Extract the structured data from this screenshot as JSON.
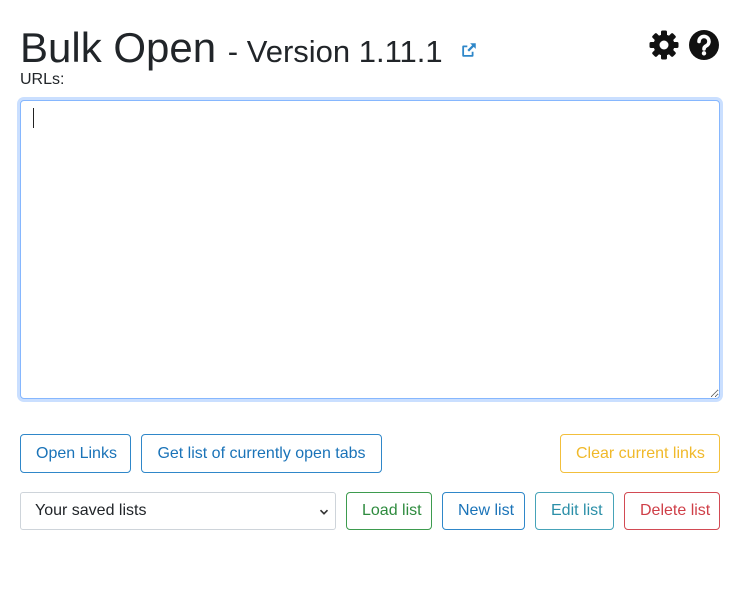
{
  "header": {
    "app_name": "Bulk Open",
    "version_text": "- Version 1.11.1",
    "icons": {
      "external_link": "external-link-icon",
      "settings": "gear-icon",
      "help": "question-circle-icon"
    }
  },
  "urls": {
    "label": "URLs:",
    "value": "",
    "placeholder": ""
  },
  "actions": {
    "open_links": "Open Links",
    "get_open_tabs": "Get list of currently open tabs",
    "clear_links": "Clear current links"
  },
  "lists": {
    "select_value": "Your saved lists",
    "load": "Load list",
    "new": "New list",
    "edit": "Edit list",
    "delete": "Delete list"
  },
  "colors": {
    "primary": "#2f87c9",
    "teal": "#46a3b8",
    "green": "#3d9b4e",
    "red": "#d24a53",
    "yellow": "#f2bf3c",
    "focus": "#86b7fe"
  }
}
